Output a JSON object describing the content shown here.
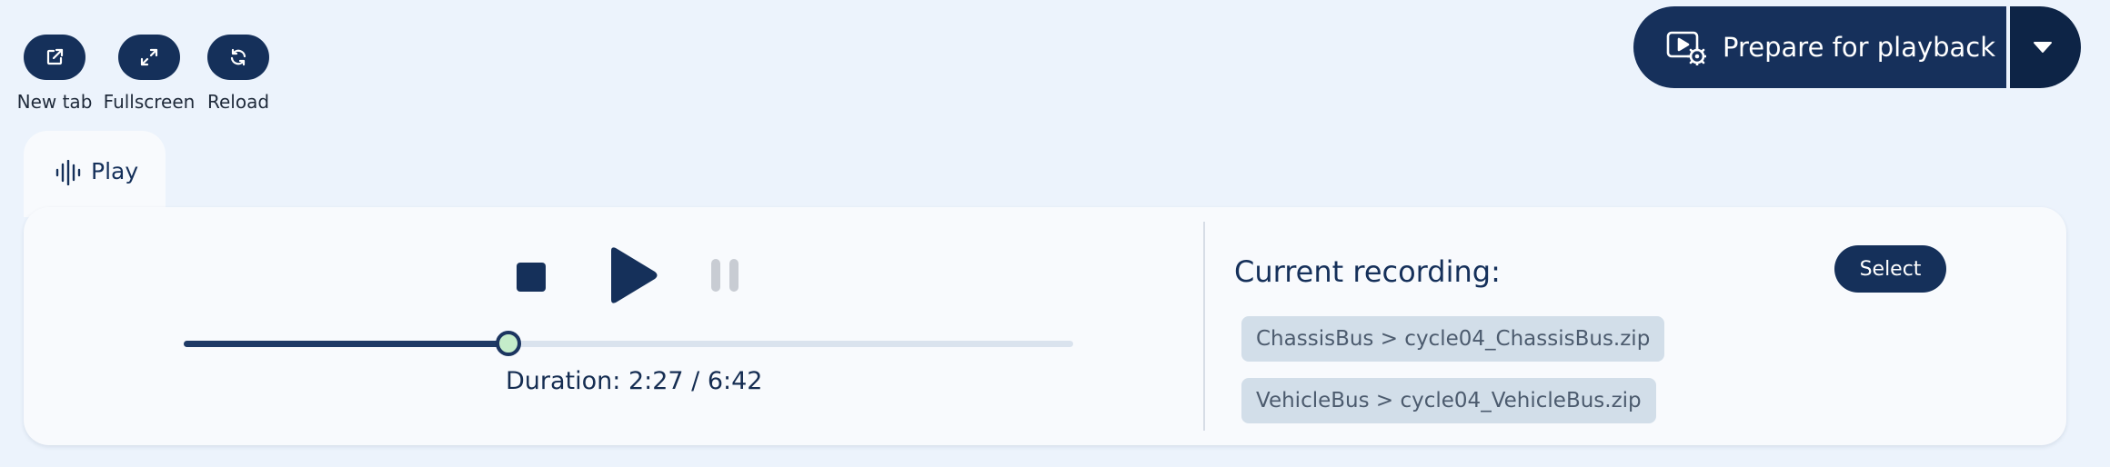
{
  "toolbar": {
    "items": [
      {
        "label": "New tab",
        "icon": "external-link-icon"
      },
      {
        "label": "Fullscreen",
        "icon": "expand-icon"
      },
      {
        "label": "Reload",
        "icon": "reload-icon"
      }
    ]
  },
  "prepare_button": {
    "label": "Prepare for playback",
    "icon": "video-settings-icon",
    "dropdown_icon": "caret-down-icon"
  },
  "tabs": [
    {
      "label": "Play",
      "icon": "waveform-icon",
      "active": true
    }
  ],
  "player": {
    "progress_fraction": 0.365,
    "elapsed": "2:27",
    "total": "6:42",
    "duration_text": "Duration: 2:27 / 6:42",
    "pause_enabled": false
  },
  "recording": {
    "title": "Current recording:",
    "select_label": "Select",
    "files": [
      "ChassisBus > cycle04_ChassisBus.zip",
      "VehicleBus > cycle04_VehicleBus.zip"
    ]
  },
  "colors": {
    "background": "#ecf3fc",
    "primary": "#15305a",
    "primary_dark": "#0d2446",
    "panel": "#f8fafd",
    "chip": "#d2dee9",
    "slider_thumb": "#c5ecca",
    "disabled": "#c8ccd3"
  }
}
